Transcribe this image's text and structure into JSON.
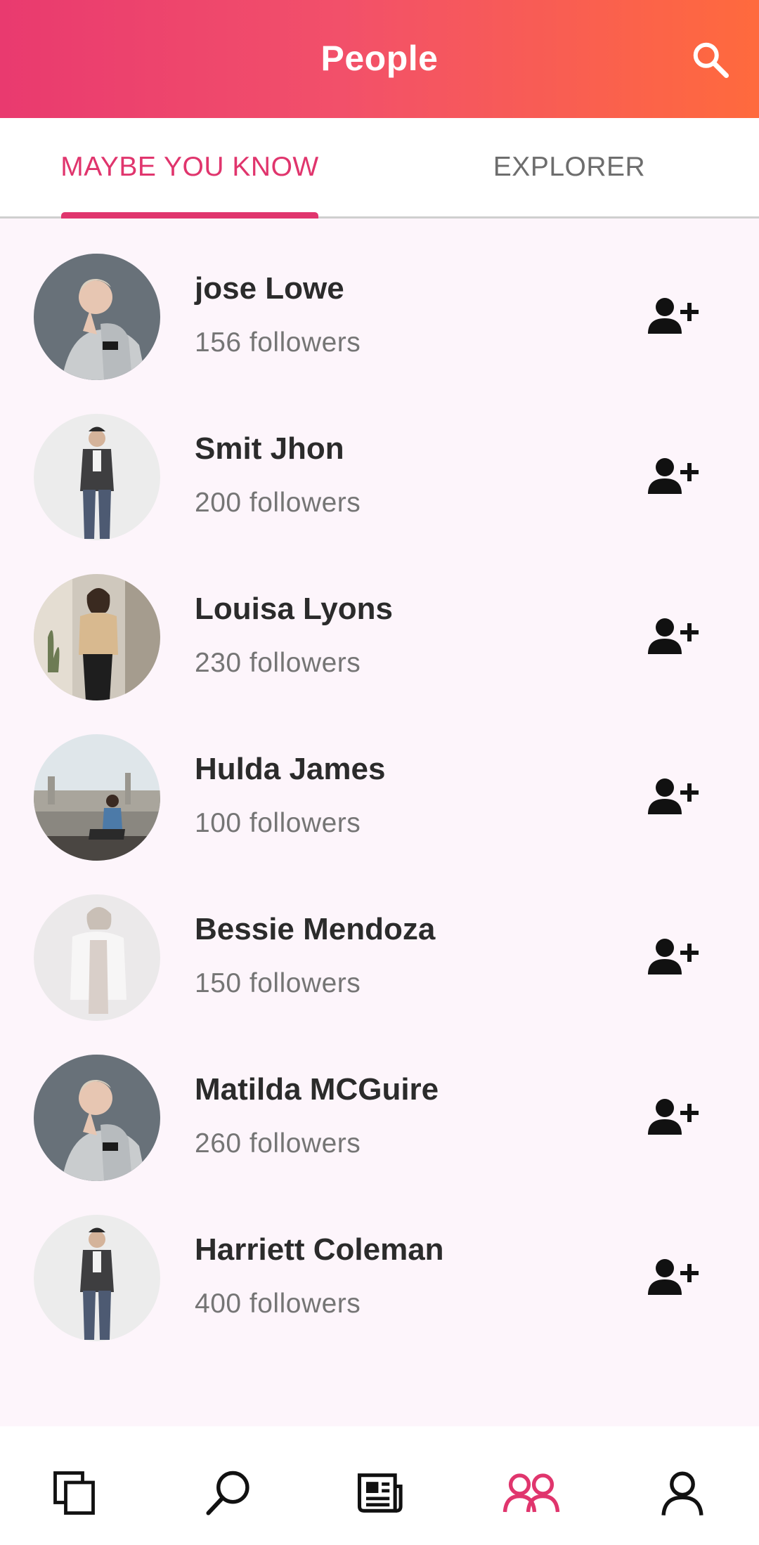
{
  "appbar": {
    "title": "People",
    "search_icon": "search-icon"
  },
  "tabs": [
    {
      "label": "MAYBE YOU KNOW",
      "active": true
    },
    {
      "label": "EXPLORER",
      "active": false
    }
  ],
  "colors": {
    "accent": "#e0356d",
    "gradient_start": "#e93a6f",
    "gradient_end": "#ff6a3d",
    "background": "#fdf5fb"
  },
  "people": [
    {
      "name": "jose Lowe",
      "followers": "156 followers"
    },
    {
      "name": "Smit Jhon",
      "followers": "200 followers"
    },
    {
      "name": "Louisa Lyons",
      "followers": "230 followers"
    },
    {
      "name": "Hulda James",
      "followers": "100 followers"
    },
    {
      "name": "Bessie Mendoza",
      "followers": "150 followers"
    },
    {
      "name": "Matilda MCGuire",
      "followers": "260 followers"
    },
    {
      "name": "Harriett Coleman",
      "followers": "400 followers"
    }
  ],
  "bottom_nav": [
    {
      "icon": "pages-icon",
      "active": false
    },
    {
      "icon": "search-icon",
      "active": false
    },
    {
      "icon": "newspaper-icon",
      "active": false
    },
    {
      "icon": "people-icon",
      "active": true
    },
    {
      "icon": "profile-icon",
      "active": false
    }
  ]
}
